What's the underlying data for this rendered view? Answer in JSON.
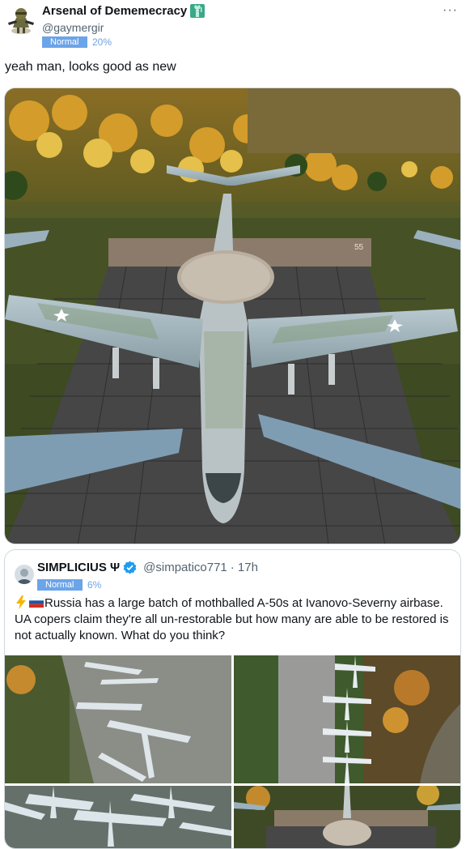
{
  "tweet": {
    "display_name": "Arsenal of Dememecracy",
    "handle": "@gaymergir",
    "badge": "Normal",
    "badge_pct": "20%",
    "text": "yeah man, looks good as new",
    "more": "···",
    "media": {
      "tail_number": "55"
    }
  },
  "quote": {
    "display_name": "SIMPLICIUS Ψ",
    "handle": "@simpatico771",
    "time": "· 17h",
    "badge": "Normal",
    "badge_pct": "6%",
    "text": "Russia has a large batch of mothballed A-50s at Ivanovo-Severny airbase. UA copers claim they're all un-restorable but how many are able to be restored is not actually known. What do you think?"
  },
  "colors": {
    "accent": "#1d9bf0",
    "badge": "#6ba4e8",
    "muted": "#536471"
  }
}
